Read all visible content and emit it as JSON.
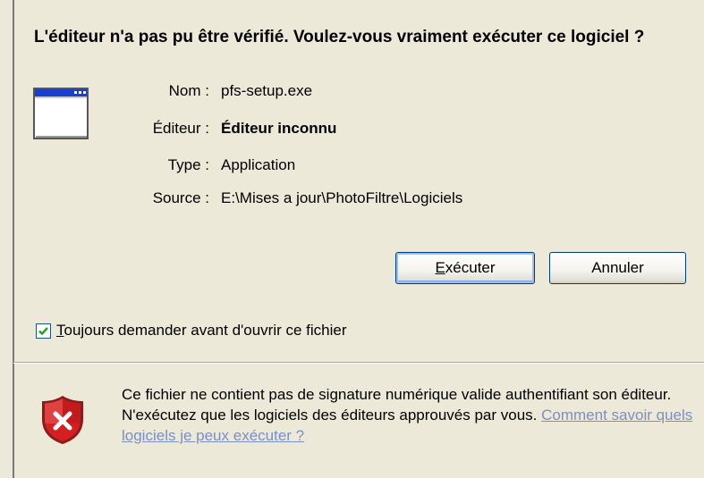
{
  "dialog": {
    "headline": "L'éditeur n'a pas pu être vérifié. Voulez-vous vraiment exécuter ce logiciel ?"
  },
  "details": {
    "name_label": "Nom :",
    "name_value": "pfs-setup.exe",
    "publisher_label": "Éditeur :",
    "publisher_value": "Éditeur inconnu",
    "type_label": "Type :",
    "type_value": "Application",
    "source_label": "Source :",
    "source_value": "E:\\Mises a jour\\PhotoFiltre\\Logiciels"
  },
  "buttons": {
    "run_accel": "E",
    "run_rest": "xécuter",
    "cancel": "Annuler"
  },
  "checkbox": {
    "checked": true,
    "label_accel": "T",
    "label_rest": "oujours demander avant d'ouvrir ce fichier"
  },
  "warning": {
    "text": "Ce fichier ne contient pas de signature numérique valide authentifiant son éditeur. N'exécutez que les logiciels des éditeurs approuvés par vous. ",
    "link": "Comment savoir quels logiciels je peux exécuter ?"
  },
  "icons": {
    "app": "application-window-icon",
    "shield": "security-shield-error-icon",
    "check": "checkmark-icon"
  },
  "colors": {
    "background": "#ece9d8",
    "link": "#7b8fc4",
    "shield_red": "#d42020",
    "check_green": "#21a121"
  }
}
